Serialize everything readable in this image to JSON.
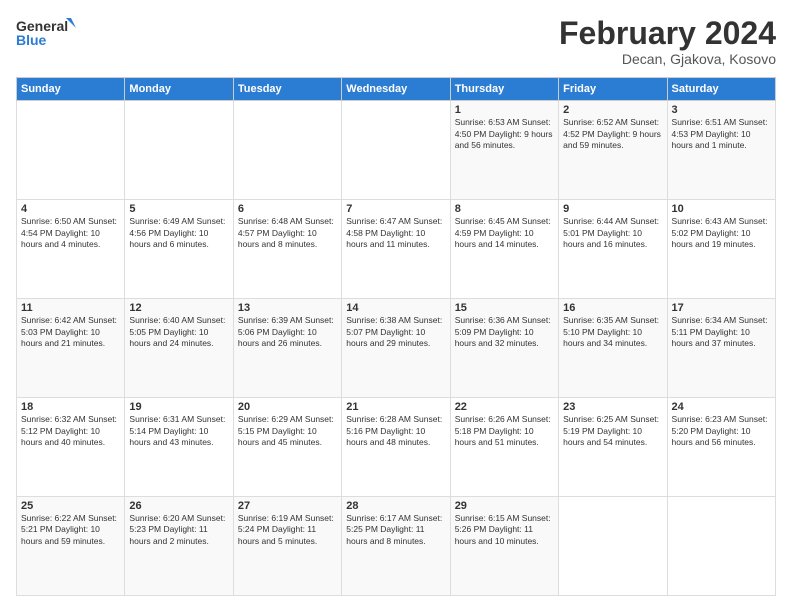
{
  "logo": {
    "line1": "General",
    "line2": "Blue"
  },
  "title": "February 2024",
  "location": "Decan, Gjakova, Kosovo",
  "days_of_week": [
    "Sunday",
    "Monday",
    "Tuesday",
    "Wednesday",
    "Thursday",
    "Friday",
    "Saturday"
  ],
  "weeks": [
    [
      {
        "day": "",
        "info": ""
      },
      {
        "day": "",
        "info": ""
      },
      {
        "day": "",
        "info": ""
      },
      {
        "day": "",
        "info": ""
      },
      {
        "day": "1",
        "info": "Sunrise: 6:53 AM\nSunset: 4:50 PM\nDaylight: 9 hours and 56 minutes."
      },
      {
        "day": "2",
        "info": "Sunrise: 6:52 AM\nSunset: 4:52 PM\nDaylight: 9 hours and 59 minutes."
      },
      {
        "day": "3",
        "info": "Sunrise: 6:51 AM\nSunset: 4:53 PM\nDaylight: 10 hours and 1 minute."
      }
    ],
    [
      {
        "day": "4",
        "info": "Sunrise: 6:50 AM\nSunset: 4:54 PM\nDaylight: 10 hours and 4 minutes."
      },
      {
        "day": "5",
        "info": "Sunrise: 6:49 AM\nSunset: 4:56 PM\nDaylight: 10 hours and 6 minutes."
      },
      {
        "day": "6",
        "info": "Sunrise: 6:48 AM\nSunset: 4:57 PM\nDaylight: 10 hours and 8 minutes."
      },
      {
        "day": "7",
        "info": "Sunrise: 6:47 AM\nSunset: 4:58 PM\nDaylight: 10 hours and 11 minutes."
      },
      {
        "day": "8",
        "info": "Sunrise: 6:45 AM\nSunset: 4:59 PM\nDaylight: 10 hours and 14 minutes."
      },
      {
        "day": "9",
        "info": "Sunrise: 6:44 AM\nSunset: 5:01 PM\nDaylight: 10 hours and 16 minutes."
      },
      {
        "day": "10",
        "info": "Sunrise: 6:43 AM\nSunset: 5:02 PM\nDaylight: 10 hours and 19 minutes."
      }
    ],
    [
      {
        "day": "11",
        "info": "Sunrise: 6:42 AM\nSunset: 5:03 PM\nDaylight: 10 hours and 21 minutes."
      },
      {
        "day": "12",
        "info": "Sunrise: 6:40 AM\nSunset: 5:05 PM\nDaylight: 10 hours and 24 minutes."
      },
      {
        "day": "13",
        "info": "Sunrise: 6:39 AM\nSunset: 5:06 PM\nDaylight: 10 hours and 26 minutes."
      },
      {
        "day": "14",
        "info": "Sunrise: 6:38 AM\nSunset: 5:07 PM\nDaylight: 10 hours and 29 minutes."
      },
      {
        "day": "15",
        "info": "Sunrise: 6:36 AM\nSunset: 5:09 PM\nDaylight: 10 hours and 32 minutes."
      },
      {
        "day": "16",
        "info": "Sunrise: 6:35 AM\nSunset: 5:10 PM\nDaylight: 10 hours and 34 minutes."
      },
      {
        "day": "17",
        "info": "Sunrise: 6:34 AM\nSunset: 5:11 PM\nDaylight: 10 hours and 37 minutes."
      }
    ],
    [
      {
        "day": "18",
        "info": "Sunrise: 6:32 AM\nSunset: 5:12 PM\nDaylight: 10 hours and 40 minutes."
      },
      {
        "day": "19",
        "info": "Sunrise: 6:31 AM\nSunset: 5:14 PM\nDaylight: 10 hours and 43 minutes."
      },
      {
        "day": "20",
        "info": "Sunrise: 6:29 AM\nSunset: 5:15 PM\nDaylight: 10 hours and 45 minutes."
      },
      {
        "day": "21",
        "info": "Sunrise: 6:28 AM\nSunset: 5:16 PM\nDaylight: 10 hours and 48 minutes."
      },
      {
        "day": "22",
        "info": "Sunrise: 6:26 AM\nSunset: 5:18 PM\nDaylight: 10 hours and 51 minutes."
      },
      {
        "day": "23",
        "info": "Sunrise: 6:25 AM\nSunset: 5:19 PM\nDaylight: 10 hours and 54 minutes."
      },
      {
        "day": "24",
        "info": "Sunrise: 6:23 AM\nSunset: 5:20 PM\nDaylight: 10 hours and 56 minutes."
      }
    ],
    [
      {
        "day": "25",
        "info": "Sunrise: 6:22 AM\nSunset: 5:21 PM\nDaylight: 10 hours and 59 minutes."
      },
      {
        "day": "26",
        "info": "Sunrise: 6:20 AM\nSunset: 5:23 PM\nDaylight: 11 hours and 2 minutes."
      },
      {
        "day": "27",
        "info": "Sunrise: 6:19 AM\nSunset: 5:24 PM\nDaylight: 11 hours and 5 minutes."
      },
      {
        "day": "28",
        "info": "Sunrise: 6:17 AM\nSunset: 5:25 PM\nDaylight: 11 hours and 8 minutes."
      },
      {
        "day": "29",
        "info": "Sunrise: 6:15 AM\nSunset: 5:26 PM\nDaylight: 11 hours and 10 minutes."
      },
      {
        "day": "",
        "info": ""
      },
      {
        "day": "",
        "info": ""
      }
    ]
  ]
}
